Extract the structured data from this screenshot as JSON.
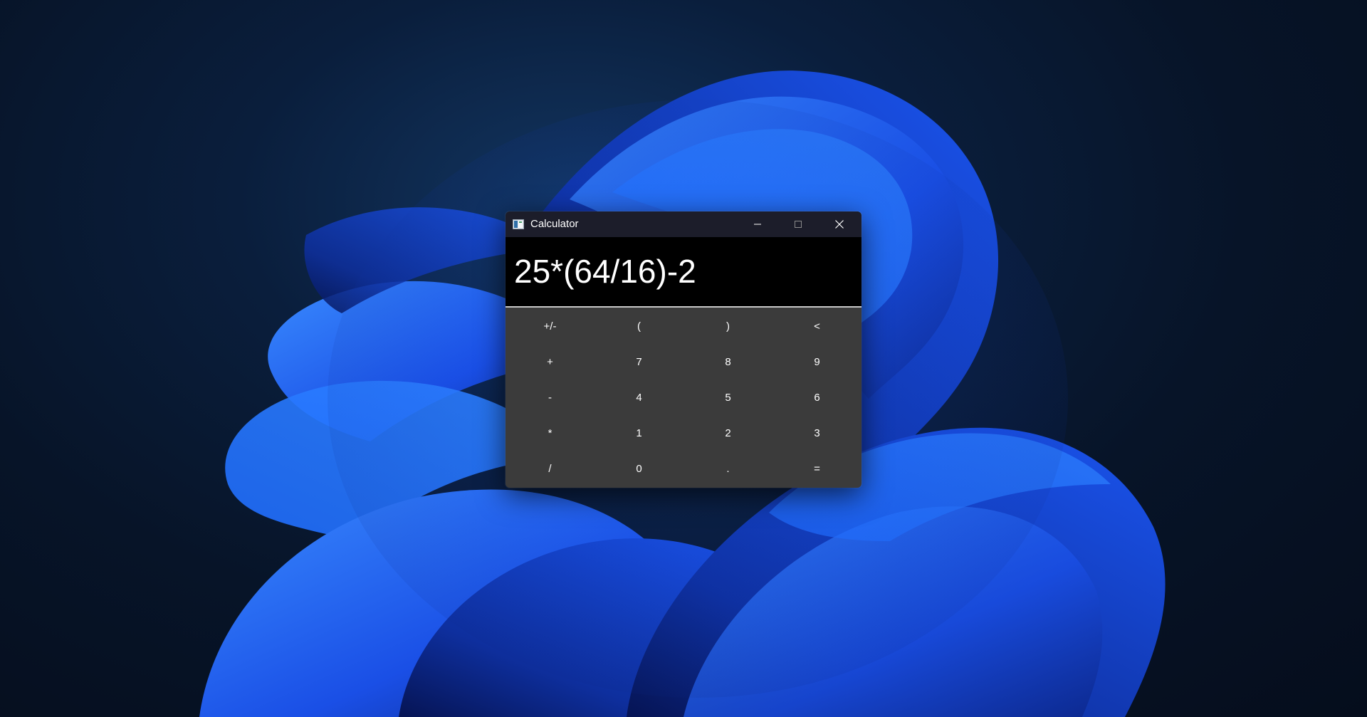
{
  "window": {
    "title": "Calculator"
  },
  "display": {
    "expression": "25*(64/16)-2"
  },
  "keypad": {
    "rows": [
      [
        "+/-",
        "(",
        ")",
        "<"
      ],
      [
        "+",
        "7",
        "8",
        "9"
      ],
      [
        "-",
        "4",
        "5",
        "6"
      ],
      [
        "*",
        "1",
        "2",
        "3"
      ],
      [
        "/",
        "0",
        ".",
        "="
      ]
    ]
  },
  "icons": {
    "app": "calculator-app-icon",
    "minimize": "minimize-icon",
    "maximize": "maximize-icon",
    "close": "close-icon"
  },
  "colors": {
    "titlebar": "#1c1d2a",
    "display_bg": "#000000",
    "keypad_bg": "#3b3b3b",
    "text": "#ffffff"
  }
}
